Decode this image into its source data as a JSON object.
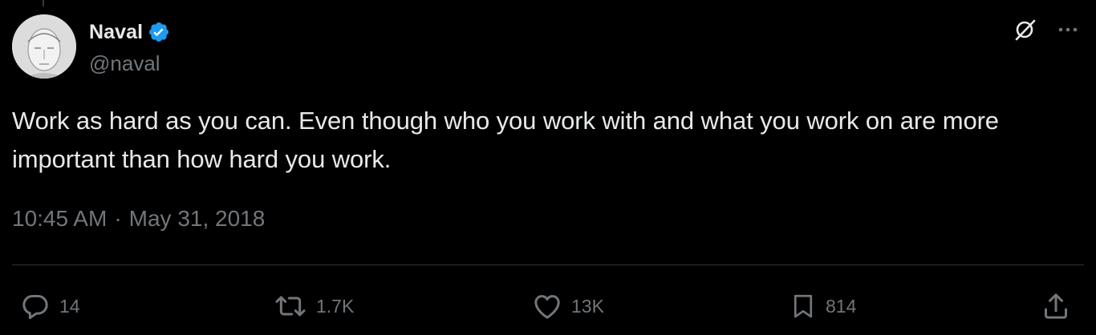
{
  "author": {
    "display_name": "Naval",
    "handle": "@naval",
    "verified": true,
    "verified_color": "#1d9bf0"
  },
  "tweet": {
    "text": "Work as hard as you can. Even though who you work with and what you work on are more important than how hard you work.",
    "time": "10:45 AM",
    "separator": "·",
    "date": "May 31, 2018"
  },
  "stats": {
    "replies": "14",
    "reposts": "1.7K",
    "likes": "13K",
    "bookmarks": "814"
  },
  "icons": {
    "top_right": [
      "grok-icon",
      "more-icon"
    ],
    "actions": [
      "reply-icon",
      "repost-icon",
      "like-icon",
      "bookmark-icon",
      "share-icon"
    ]
  },
  "colors": {
    "background": "#000000",
    "primary_text": "#e7e9ea",
    "secondary_text": "#71767b",
    "divider": "#2f3336"
  }
}
